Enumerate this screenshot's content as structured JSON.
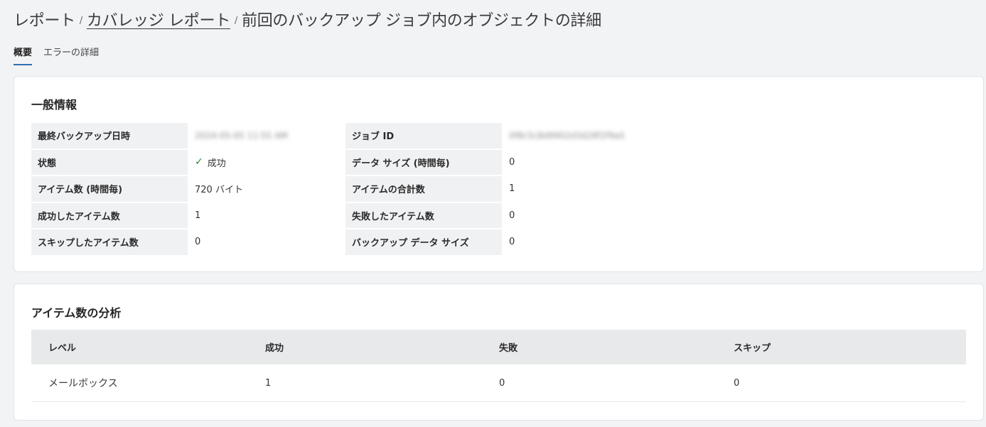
{
  "breadcrumb": {
    "item1": "レポート",
    "item2": "カバレッジ レポート",
    "item3": "前回のバックアップ ジョブ内のオブジェクトの詳細",
    "separator": "/"
  },
  "tabs": [
    {
      "label": "概要"
    },
    {
      "label": "エラーの詳細"
    }
  ],
  "general": {
    "title": "一般情報",
    "rows": [
      {
        "l1": "最終バックアップ日時",
        "v1": "2024-05-05 11:55 AM",
        "l2": "ジョブ ID",
        "v2": "0f8c5c8d9902d3d28f2f9a5"
      },
      {
        "l1": "状態",
        "v1": "成功",
        "l2": "データ サイズ (時間毎)",
        "v2": "0"
      },
      {
        "l1": "アイテム数 (時間毎)",
        "v1": "720 バイト",
        "l2": "アイテムの合計数",
        "v2": "1"
      },
      {
        "l1": "成功したアイテム数",
        "v1": "1",
        "l2": "失敗したアイテム数",
        "v2": "0"
      },
      {
        "l1": "スキップしたアイテム数",
        "v1": "0",
        "l2": "バックアップ データ サイズ",
        "v2": "0"
      }
    ]
  },
  "analysis": {
    "title": "アイテム数の分析",
    "headers": [
      "レベル",
      "成功",
      "失敗",
      "スキップ"
    ],
    "rows": [
      [
        "メールボックス",
        "1",
        "0",
        "0"
      ]
    ]
  }
}
